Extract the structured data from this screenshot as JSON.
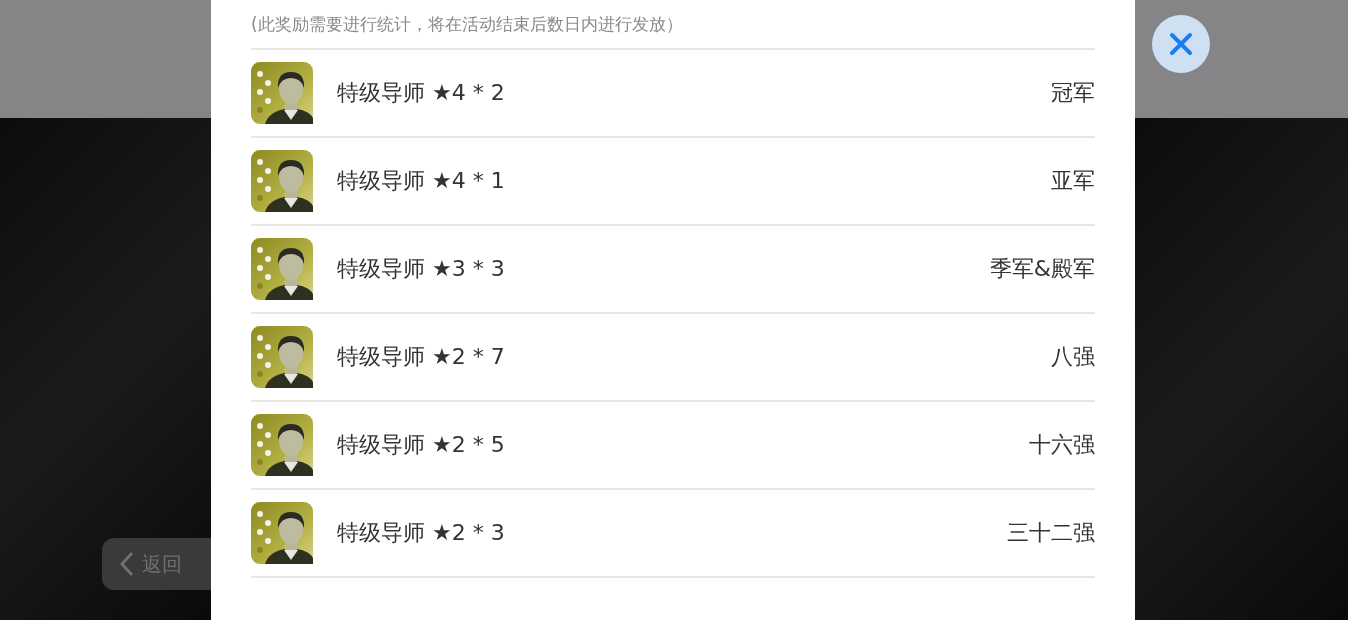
{
  "back_button": {
    "label": "返回"
  },
  "dialog": {
    "note": "(此奖励需要进行统计，将在活动结束后数日内进行发放）",
    "rewards": [
      {
        "name": "特级导师 ★4 * 2",
        "rank": "冠军"
      },
      {
        "name": "特级导师 ★4 * 1",
        "rank": "亚军"
      },
      {
        "name": "特级导师 ★3 * 3",
        "rank": "季军&殿军"
      },
      {
        "name": "特级导师 ★2 * 7",
        "rank": "八强"
      },
      {
        "name": "特级导师 ★2 * 5",
        "rank": "十六强"
      },
      {
        "name": "特级导师 ★2 * 3",
        "rank": "三十二强"
      }
    ]
  }
}
